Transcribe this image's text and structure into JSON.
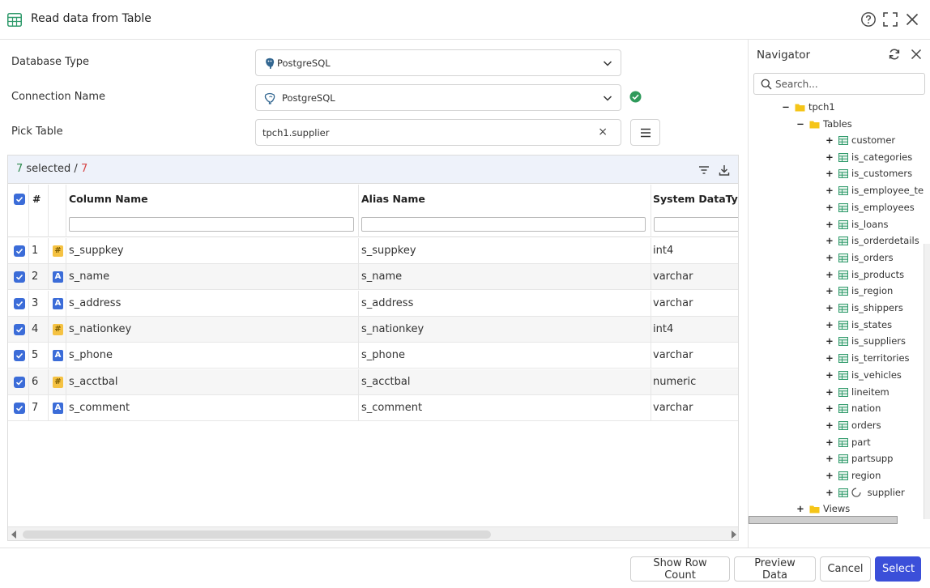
{
  "window": {
    "title": "Read data from Table",
    "help_icon": "help-circle-icon",
    "maximize_icon": "maximize-icon",
    "close_icon": "close-icon"
  },
  "form": {
    "database_type": {
      "label": "Database Type",
      "value": "PostgreSQL",
      "icon": "postgresql-icon"
    },
    "connection_name": {
      "label": "Connection Name",
      "value": "PostgreSQL",
      "icon": "postgresql-icon",
      "status": "connected"
    },
    "pick_table": {
      "label": "Pick Table",
      "value": "tpch1.supplier",
      "clear": "×"
    }
  },
  "grid": {
    "selected_count": "7",
    "selected_text": " selected / ",
    "total_count": "7",
    "columns": [
      "#",
      "Column Name",
      "Alias Name",
      "System DataTyp"
    ],
    "rows": [
      {
        "num": "1",
        "type": "#",
        "column": "s_suppkey",
        "alias": "s_suppkey",
        "datatype": "int4"
      },
      {
        "num": "2",
        "type": "A",
        "column": "s_name",
        "alias": "s_name",
        "datatype": "varchar"
      },
      {
        "num": "3",
        "type": "A",
        "column": "s_address",
        "alias": "s_address",
        "datatype": "varchar"
      },
      {
        "num": "4",
        "type": "#",
        "column": "s_nationkey",
        "alias": "s_nationkey",
        "datatype": "int4"
      },
      {
        "num": "5",
        "type": "A",
        "column": "s_phone",
        "alias": "s_phone",
        "datatype": "varchar"
      },
      {
        "num": "6",
        "type": "#",
        "column": "s_acctbal",
        "alias": "s_acctbal",
        "datatype": "numeric"
      },
      {
        "num": "7",
        "type": "A",
        "column": "s_comment",
        "alias": "s_comment",
        "datatype": "varchar"
      }
    ]
  },
  "navigator": {
    "title": "Navigator",
    "search_placeholder": "Search...",
    "schema": "tpch1",
    "tables_folder": "Tables",
    "tables": [
      "customer",
      "is_categories",
      "is_customers",
      "is_employee_te",
      "is_employees",
      "is_loans",
      "is_orderdetails",
      "is_orders",
      "is_products",
      "is_region",
      "is_shippers",
      "is_states",
      "is_suppliers",
      "is_territories",
      "is_vehicles",
      "lineitem",
      "nation",
      "orders",
      "part",
      "partsupp",
      "region",
      "supplier"
    ],
    "views_folder": "Views"
  },
  "footer": {
    "show_row_count": "Show Row Count",
    "preview_data": "Preview Data",
    "cancel": "Cancel",
    "select": "Select"
  },
  "colors": {
    "accent": "#3b4fd9",
    "checkbox": "#3b6cd8",
    "selected_green": "#2d8a4e",
    "total_red": "#d64545",
    "toolbar_bg": "#eef2fa",
    "folder": "#f5c518",
    "table_icon": "#2f9a6b"
  }
}
